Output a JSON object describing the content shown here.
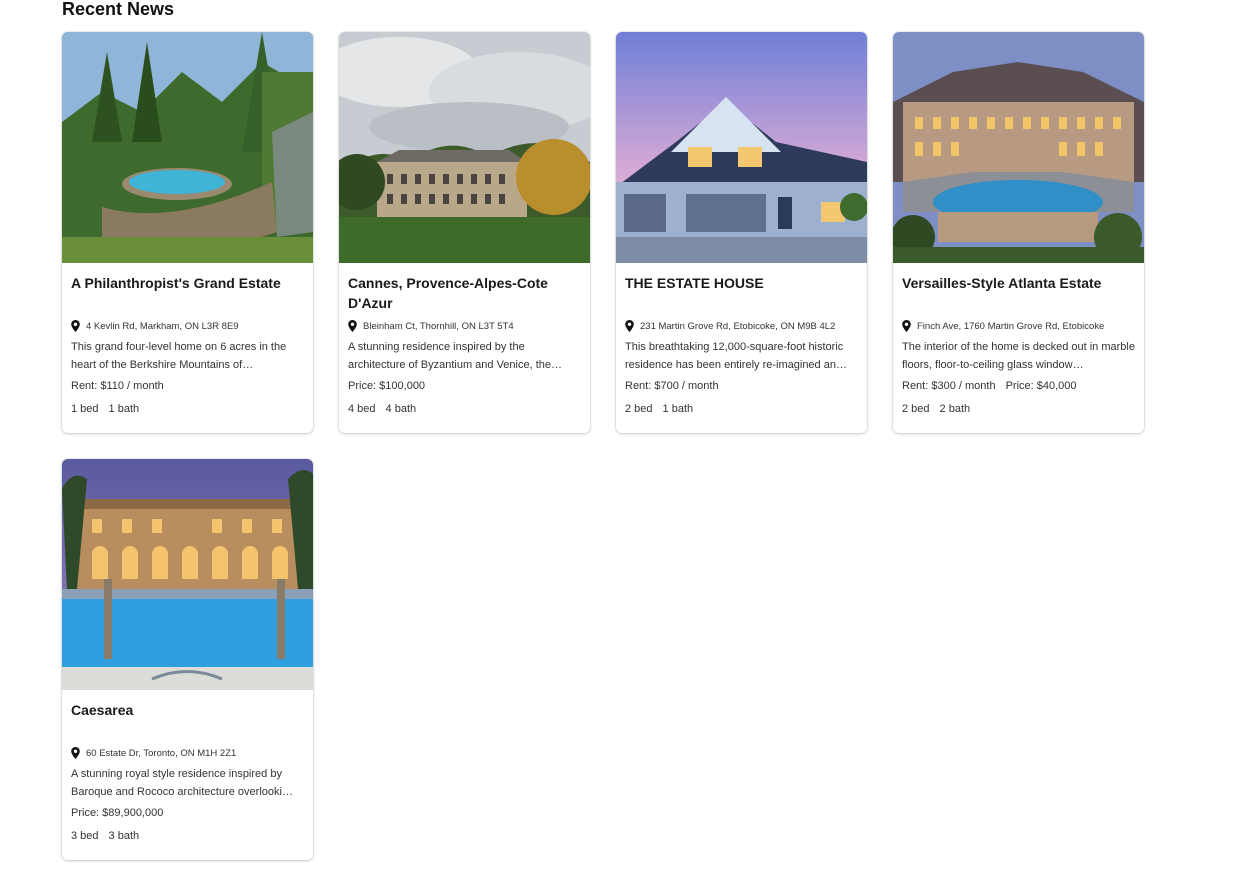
{
  "section": {
    "title": "Recent News"
  },
  "cards": [
    {
      "title": "A Philanthropist's Grand Estate",
      "address": "4 Kevlin Rd, Markham, ON L3R 8E9",
      "description": "This grand four-level home on 6 acres in the heart of the Berkshire Mountains of…",
      "rent": "Rent: $110 / month",
      "price": "",
      "beds": "1 bed",
      "baths": "1 bath"
    },
    {
      "title": "Cannes, Provence-Alpes-Cote D'Azur",
      "address": "Bleinham Ct, Thornhill, ON L3T 5T4",
      "description": "A stunning residence inspired by the architecture of Byzantium and Venice, the…",
      "rent": "",
      "price": "Price: $100,000",
      "beds": "4 bed",
      "baths": "4 bath"
    },
    {
      "title": "THE ESTATE HOUSE",
      "address": "231 Martin Grove Rd, Etobicoke, ON M9B 4L2",
      "description": "This breathtaking 12,000-square-foot historic residence has been entirely re-imagined an…",
      "rent": "Rent: $700 / month",
      "price": "",
      "beds": "2 bed",
      "baths": "1 bath"
    },
    {
      "title": "Versailles-Style Atlanta Estate",
      "address": "Finch Ave, 1760 Martin Grove Rd, Etobicoke",
      "description": "The interior of the home is decked out in marble floors, floor-to-ceiling glass window…",
      "rent": "Rent: $300 / month",
      "price": "Price: $40,000",
      "beds": "2 bed",
      "baths": "2 bath"
    },
    {
      "title": "Caesarea",
      "address": "60 Estate Dr, Toronto, ON M1H 2Z1",
      "description": "A stunning royal style residence inspired by Baroque and Rococo architecture overlooki…",
      "rent": "",
      "price": "Price: $89,900,000",
      "beds": "3 bed",
      "baths": "3 bath"
    }
  ],
  "icons": {
    "location": "map-pin-icon"
  }
}
